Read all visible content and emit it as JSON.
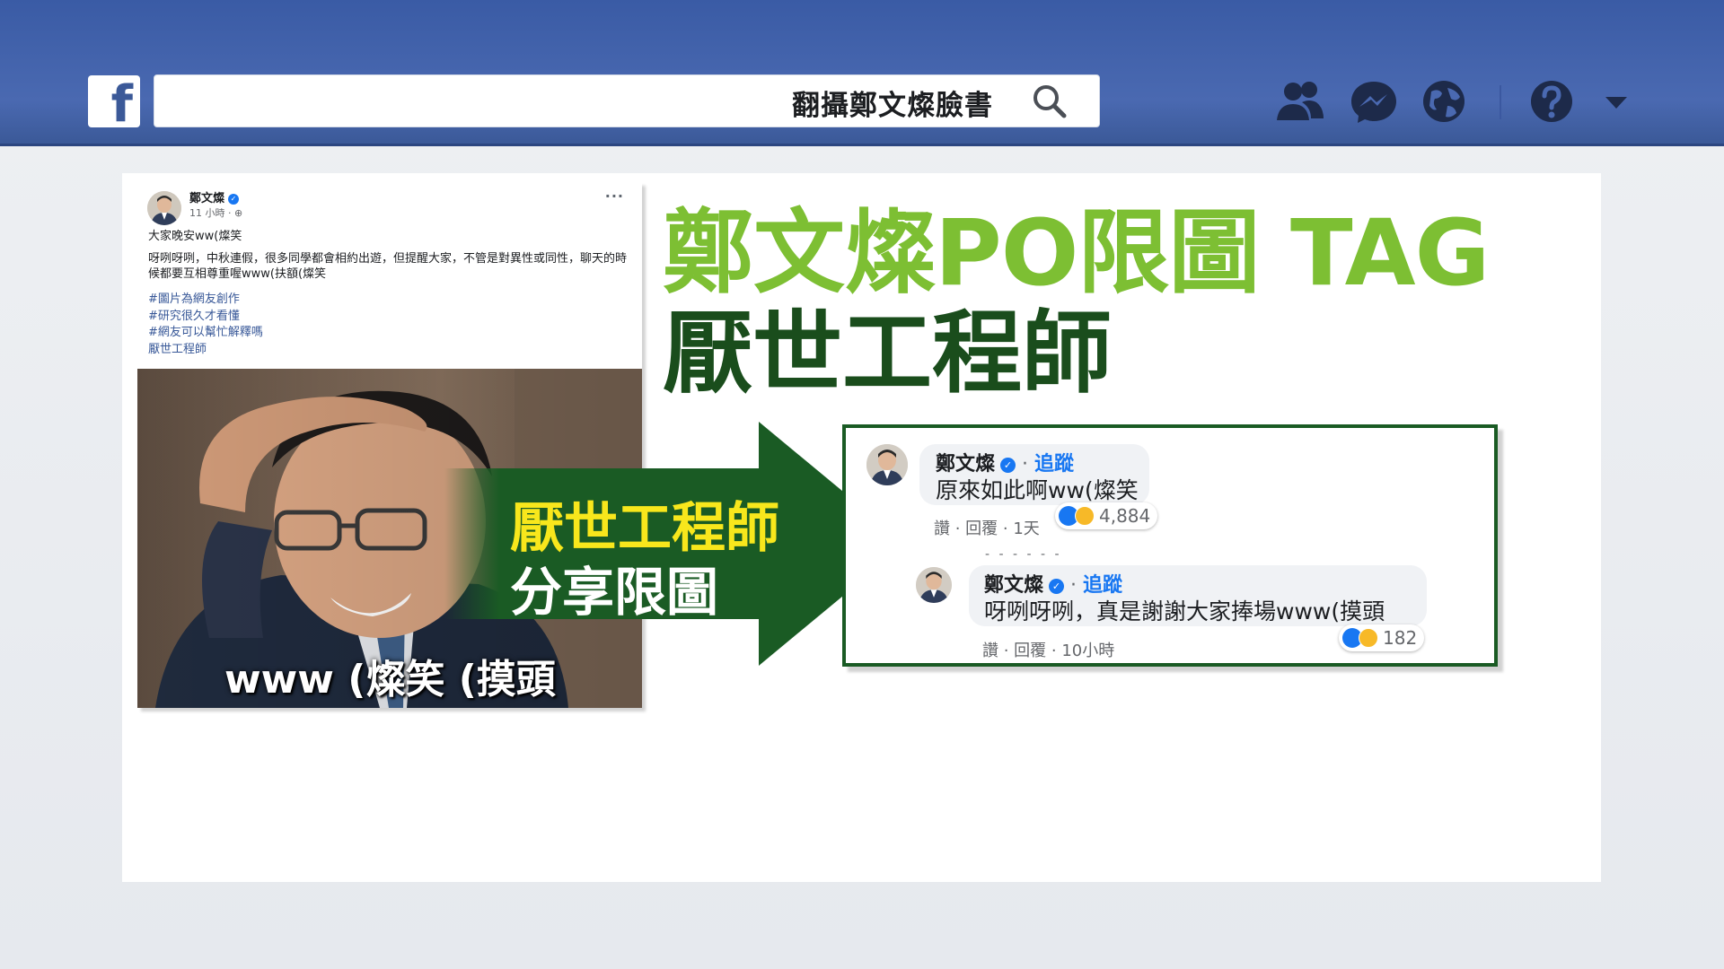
{
  "topbar": {
    "logo_letter": "f",
    "search_text": "翻攝鄭文燦臉書"
  },
  "post": {
    "author": "鄭文燦",
    "time": "11 小時 · ",
    "more": "···",
    "line1": "大家晚安ww(燦笑",
    "line2": "呀咧呀咧，中秋連假，很多同學都會相約出遊，但提醒大家，不管是對異性或同性，聊天的時候都要互相尊重喔www(扶額(燦笑",
    "hashtags": [
      "#圖片為網友創作",
      "#研究很久才看懂",
      "#網友可以幫忙解釋嗎",
      "厭世工程師"
    ],
    "photo_caption": "www (燦笑 (摸頭"
  },
  "headline": {
    "line1": "鄭文燦PO限圖 TAG",
    "line2": "厭世工程師"
  },
  "arrow": {
    "line1": "厭世工程師",
    "line2": "分享限圖"
  },
  "comments": [
    {
      "author": "鄭文燦",
      "dot": " · ",
      "follow": "追蹤",
      "text": "原來如此啊ww(燦笑",
      "actions": "讚 · 回覆 · 1天",
      "reactions": "4,884"
    },
    {
      "author": "鄭文燦",
      "dot": " · ",
      "follow": "追蹤",
      "text": "呀咧呀咧，真是謝謝大家捧場www(摸頭",
      "actions": "讚 · 回覆 · 10小時",
      "reactions": "182"
    }
  ],
  "colors": {
    "facebook_blue": "#3b5998",
    "headline_green": "#7dbf33",
    "headline_dark_green": "#1a4d1c",
    "arrow_green": "#1a5b24",
    "arrow_yellow": "#f8e71c"
  }
}
